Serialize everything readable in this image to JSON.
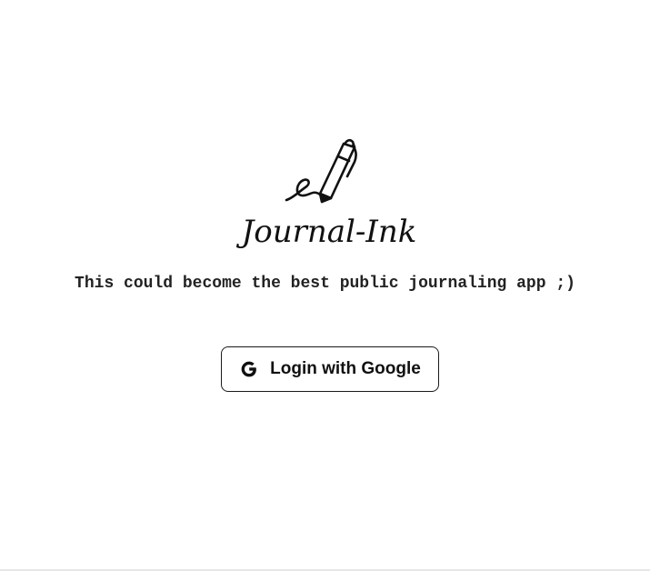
{
  "app": {
    "logo_text": "Journal-Ink",
    "logo_icon": "pen-signature-icon"
  },
  "tagline": "This could become the best public journaling app ;)",
  "login": {
    "label": "Login with Google",
    "icon": "google-icon"
  },
  "colors": {
    "background": "#ffffff",
    "text": "#222222",
    "border": "#1a1a1a"
  }
}
